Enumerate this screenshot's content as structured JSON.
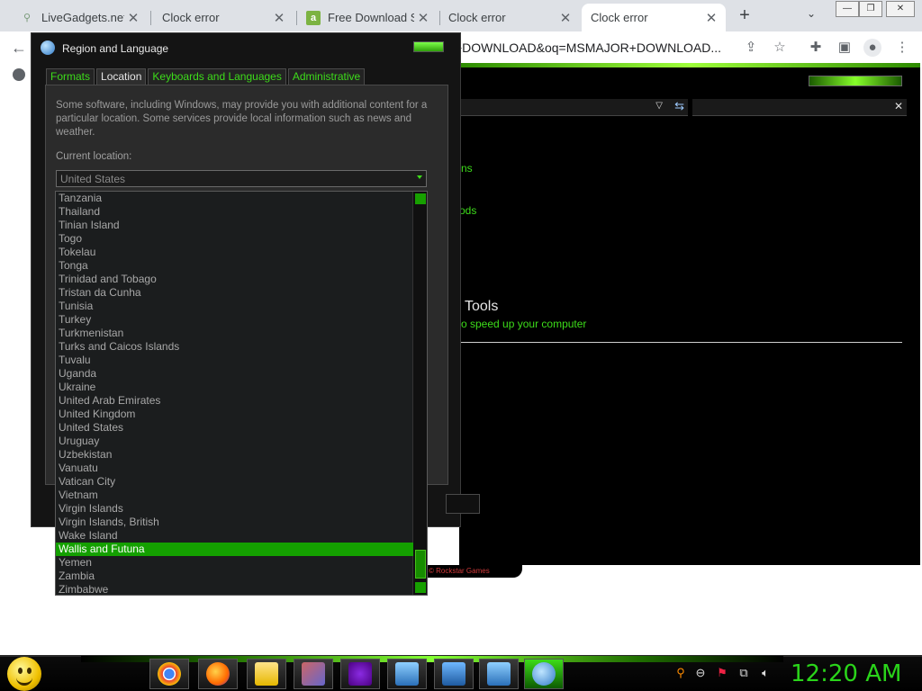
{
  "browser": {
    "tabs": [
      {
        "title": "LiveGadgets.net -",
        "favicon": "leaf-icon",
        "x": 0
      },
      {
        "title": "Clock error",
        "favicon": "none",
        "x": 0
      },
      {
        "title": "Free Download S",
        "favicon": "a-letter-icon",
        "x": 0
      },
      {
        "title": "Clock error",
        "favicon": "none",
        "x": 0
      },
      {
        "title": "Clock error",
        "favicon": "none",
        "x": 0
      }
    ],
    "close_glyph": "✕",
    "new_tab_glyph": "+",
    "tab_dropdown_glyph": "⌄",
    "url_fragment": "+DOWNLOAD&oq=MSMAJOR+DOWNLOAD...",
    "back_glyph": "←"
  },
  "background_app": {
    "link1": "ns",
    "link2": "ods",
    "heading": "Tools",
    "subtext": "o speed up your computer",
    "footer": "© Rockstar Games"
  },
  "dialog": {
    "title": "Region and Language",
    "tabs": [
      "Formats",
      "Location",
      "Keyboards and Languages",
      "Administrative"
    ],
    "active_tab": "Location",
    "description": "Some software, including Windows, may provide you with additional content for a particular location. Some services provide local information such as news and weather.",
    "current_location_label": "Current location:",
    "current_location_value": "United States"
  },
  "dropdown": {
    "items": [
      "Tanzania",
      "Thailand",
      "Tinian Island",
      "Togo",
      "Tokelau",
      "Tonga",
      "Trinidad and Tobago",
      "Tristan da Cunha",
      "Tunisia",
      "Turkey",
      "Turkmenistan",
      "Turks and Caicos Islands",
      "Tuvalu",
      "Uganda",
      "Ukraine",
      "United Arab Emirates",
      "United Kingdom",
      "United States",
      "Uruguay",
      "Uzbekistan",
      "Vanuatu",
      "Vatican City",
      "Vietnam",
      "Virgin Islands",
      "Virgin Islands, British",
      "Wake Island",
      "Wallis and Futuna",
      "Yemen",
      "Zambia",
      "Zimbabwe"
    ],
    "selected": "Wallis and Futuna"
  },
  "taskbar": {
    "apps": [
      "chrome-icon",
      "firefox-icon",
      "folder-icon",
      "media-icon",
      "yahoo-messenger-icon",
      "remote-desktop-icon",
      "network-icon",
      "display-icon",
      "clock-gadget-icon"
    ],
    "clock": "12:20 AM"
  },
  "colors": {
    "accent_green": "#3ddc1a",
    "selection_green": "#14a000",
    "dialog_bg": "#141414"
  }
}
